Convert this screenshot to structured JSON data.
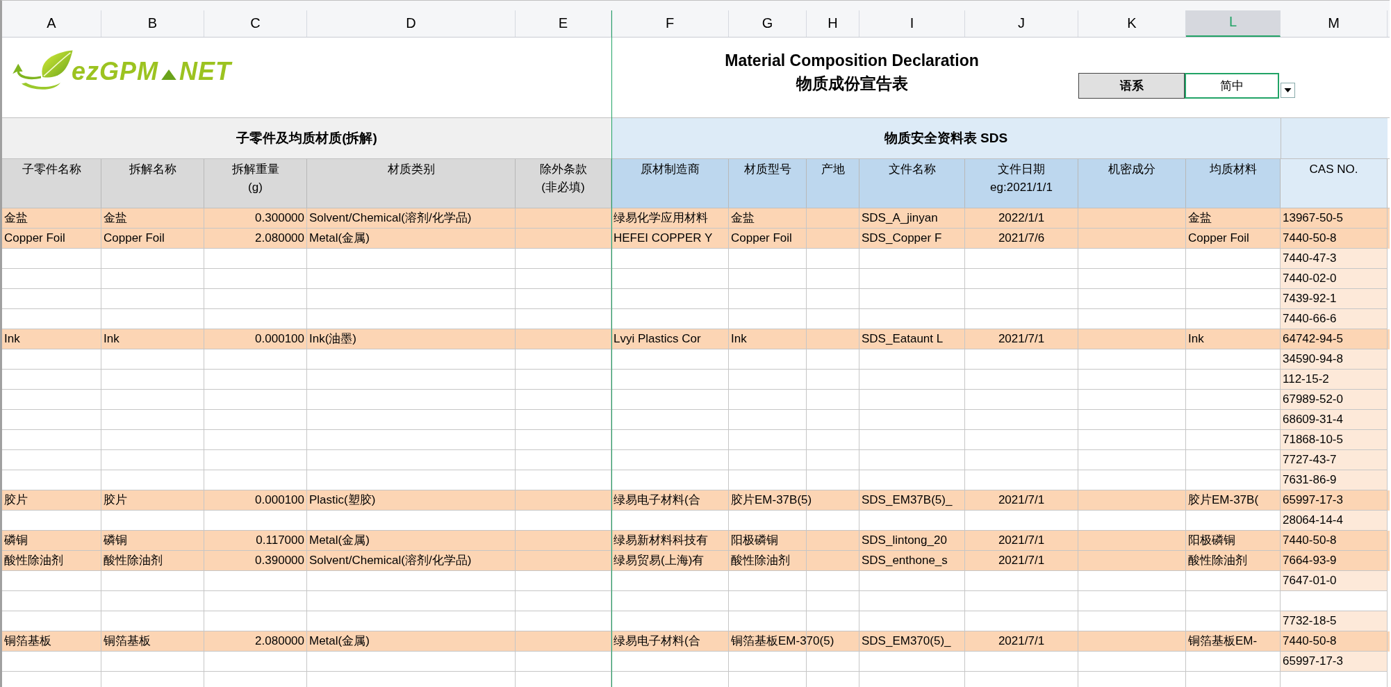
{
  "column_letters": [
    {
      "letter": "A",
      "selected": false
    },
    {
      "letter": "B",
      "selected": false
    },
    {
      "letter": "C",
      "selected": false
    },
    {
      "letter": "D",
      "selected": false
    },
    {
      "letter": "E",
      "selected": false
    },
    {
      "letter": "F",
      "selected": false
    },
    {
      "letter": "G",
      "selected": false
    },
    {
      "letter": "H",
      "selected": false
    },
    {
      "letter": "I",
      "selected": false
    },
    {
      "letter": "J",
      "selected": false
    },
    {
      "letter": "K",
      "selected": false
    },
    {
      "letter": "L",
      "selected": true
    },
    {
      "letter": "M",
      "selected": false
    }
  ],
  "logo": {
    "name": "ezGPM",
    "suffix": "NET"
  },
  "title": {
    "english": "Material Composition Declaration",
    "chinese": "物质成份宣告表"
  },
  "language": {
    "label": "语系",
    "value": "简中"
  },
  "sections": [
    "子零件及均质材质(拆解)",
    "物质安全资料表 SDS"
  ],
  "column_labels": [
    "子零件名称",
    "拆解名称",
    "拆解重量\n(g)",
    "材质类别",
    "除外条款\n(非必填)",
    "原材制造商",
    "材质型号",
    "产地",
    "文件名称",
    "文件日期\neg:2021/1/1",
    "机密成分",
    "均质材料",
    "CAS NO."
  ],
  "rows": [
    {
      "highlighted": true,
      "cells": {
        "A": "金盐",
        "B": "金盐",
        "C": "0.300000",
        "D": "Solvent/Chemical(溶剂/化学品)",
        "F": "绿易化学应用材料",
        "G": "金盐",
        "I": "SDS_A_jinyan",
        "J": "2022/1/1",
        "L": "金盐",
        "M": "13967-50-5"
      }
    },
    {
      "highlighted": true,
      "cells": {
        "A": "Copper Foil",
        "B": "Copper Foil",
        "C": "2.080000",
        "D": "Metal(金属)",
        "F": "HEFEI COPPER Y",
        "G": "Copper Foil",
        "I": "SDS_Copper F",
        "J": "2021/7/6",
        "L": "Copper Foil",
        "M": "7440-50-8"
      }
    },
    {
      "highlighted": false,
      "cells": {
        "M": "7440-47-3"
      }
    },
    {
      "highlighted": false,
      "cells": {
        "M": "7440-02-0"
      }
    },
    {
      "highlighted": false,
      "cells": {
        "M": "7439-92-1"
      }
    },
    {
      "highlighted": false,
      "cells": {
        "M": "7440-66-6"
      }
    },
    {
      "highlighted": true,
      "cells": {
        "A": "Ink",
        "B": "Ink",
        "C": "0.000100",
        "D": "Ink(油墨)",
        "F": "Lvyi Plastics Cor",
        "G": "Ink",
        "I": "SDS_Eataunt L",
        "J": "2021/7/1",
        "L": "Ink",
        "M": "64742-94-5"
      }
    },
    {
      "highlighted": false,
      "cells": {
        "M": "34590-94-8"
      }
    },
    {
      "highlighted": false,
      "cells": {
        "M": "112-15-2"
      }
    },
    {
      "highlighted": false,
      "cells": {
        "M": "67989-52-0"
      }
    },
    {
      "highlighted": false,
      "cells": {
        "M": "68609-31-4"
      }
    },
    {
      "highlighted": false,
      "cells": {
        "M": "71868-10-5"
      }
    },
    {
      "highlighted": false,
      "cells": {
        "M": "7727-43-7"
      }
    },
    {
      "highlighted": false,
      "cells": {
        "M": "7631-86-9"
      }
    },
    {
      "highlighted": true,
      "cells": {
        "A": "胶片",
        "B": "胶片",
        "C": "0.000100",
        "D": "Plastic(塑胶)",
        "F": "绿易电子材料(合",
        "G": "胶片EM-37B(5)",
        "I": "SDS_EM37B(5)_",
        "J": "2021/7/1",
        "L": "胶片EM-37B(",
        "M": "65997-17-3"
      }
    },
    {
      "highlighted": false,
      "cells": {
        "M": "28064-14-4"
      }
    },
    {
      "highlighted": true,
      "cells": {
        "A": "磷铜",
        "B": "磷铜",
        "C": "0.117000",
        "D": "Metal(金属)",
        "F": "绿易新材料科技有",
        "G": "阳极磷铜",
        "I": "SDS_lintong_20",
        "J": "2021/7/1",
        "L": "阳极磷铜",
        "M": "7440-50-8"
      }
    },
    {
      "highlighted": true,
      "cells": {
        "A": "酸性除油剂",
        "B": "酸性除油剂",
        "C": "0.390000",
        "D": "Solvent/Chemical(溶剂/化学品)",
        "F": "绿易贸易(上海)有",
        "G": "酸性除油剂",
        "I": "SDS_enthone_s",
        "J": "2021/7/1",
        "L": "酸性除油剂",
        "M": "7664-93-9"
      }
    },
    {
      "highlighted": false,
      "cells": {
        "M": "7647-01-0"
      }
    },
    {
      "highlighted": false
    },
    {
      "highlighted": false,
      "cells": {
        "M": "7732-18-5"
      }
    },
    {
      "highlighted": true,
      "cells": {
        "A": "铜箔基板",
        "B": "铜箔基板",
        "C": "2.080000",
        "D": "Metal(金属)",
        "F": "绿易电子材料(合",
        "G": "铜箔基板EM-370(5)",
        "I": "SDS_EM370(5)_",
        "J": "2021/7/1",
        "L": "铜箔基板EM-",
        "M": "7440-50-8"
      }
    },
    {
      "highlighted": false,
      "cells": {
        "M": "65997-17-3"
      }
    },
    {
      "highlighted": false
    }
  ]
}
